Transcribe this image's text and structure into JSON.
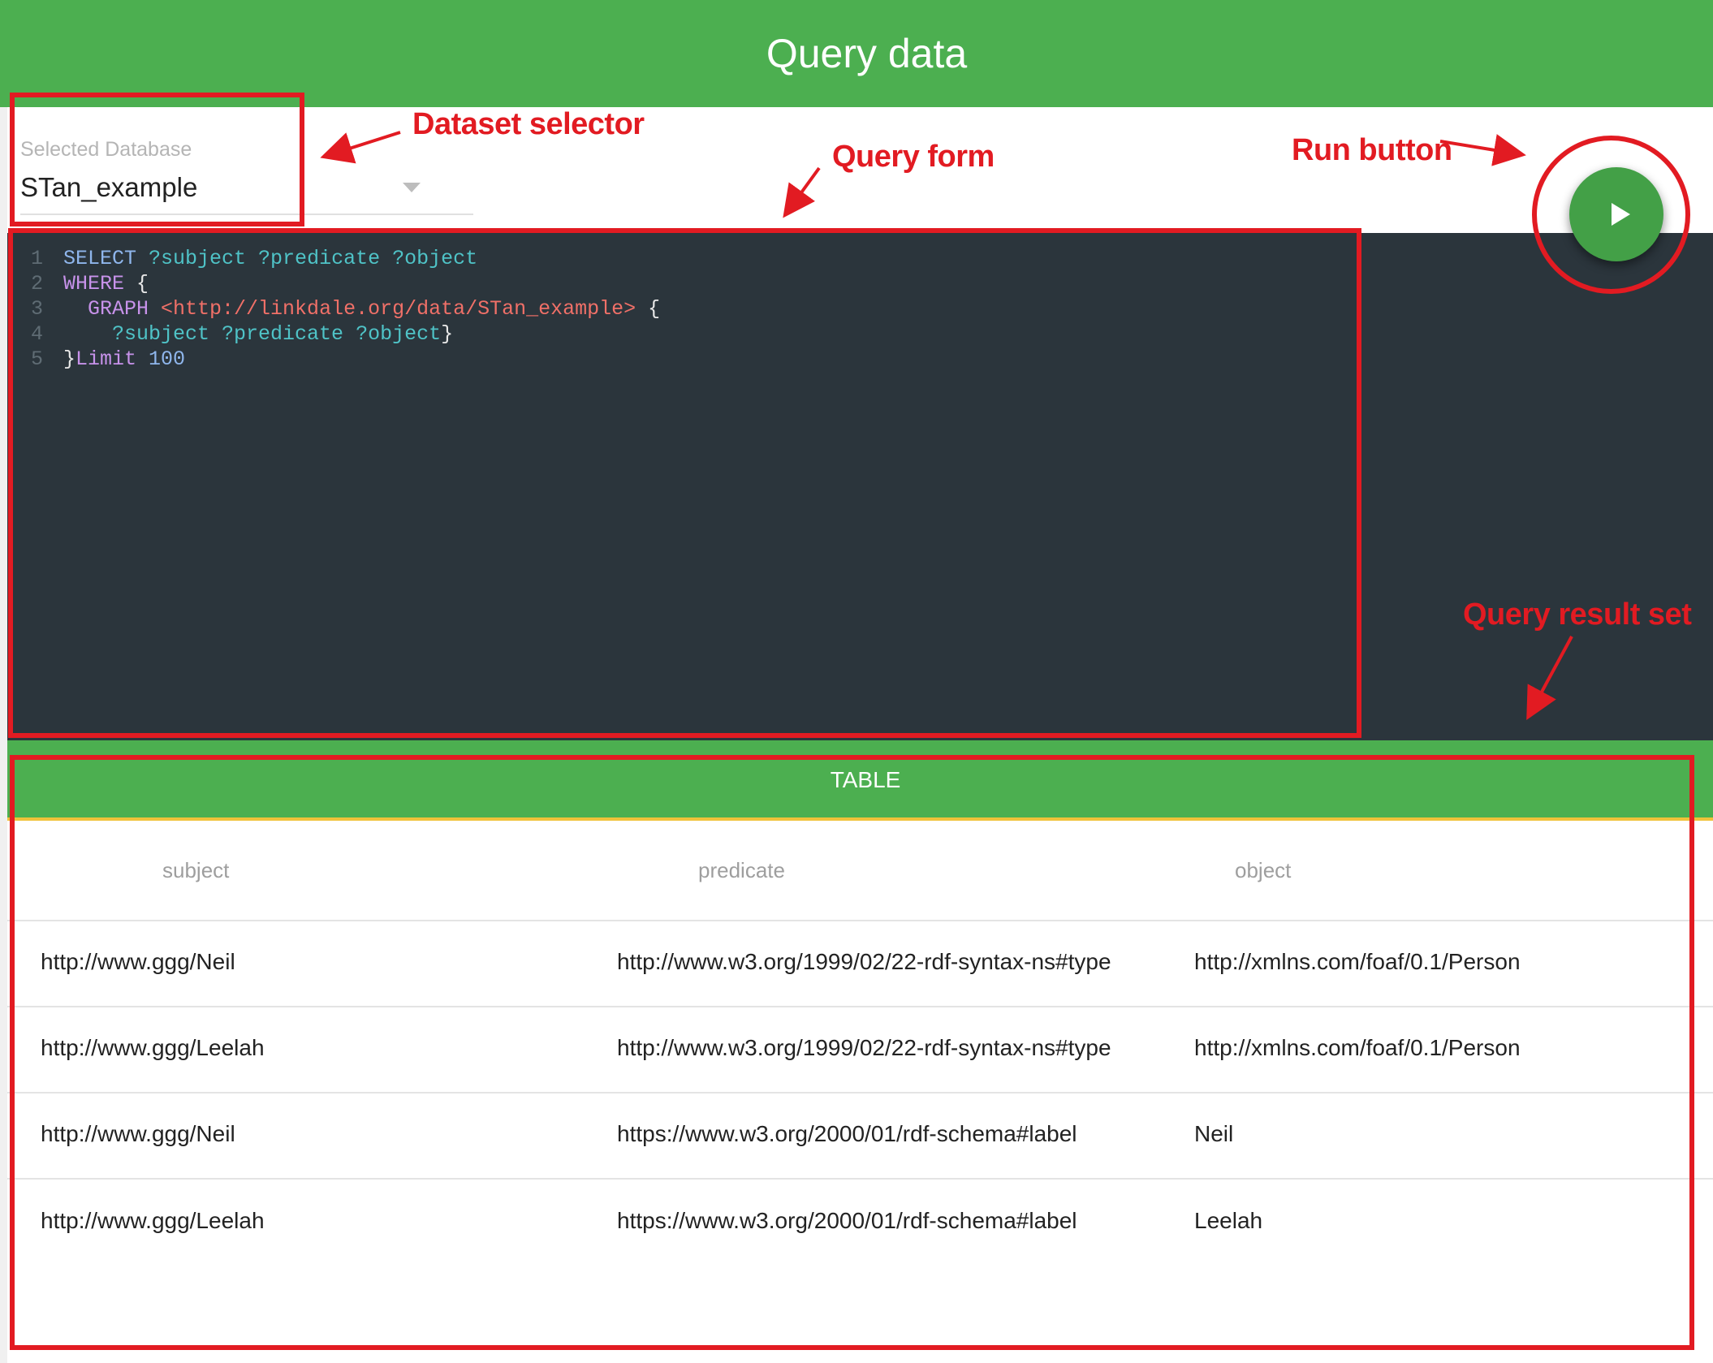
{
  "header": {
    "title": "Query data"
  },
  "database_selector": {
    "label": "Selected Database",
    "value": "STan_example"
  },
  "editor": {
    "lines": [
      {
        "num": "1",
        "tokens": [
          {
            "t": "SELECT ",
            "c": "kw"
          },
          {
            "t": "?subject ?predicate ?object",
            "c": "var"
          }
        ]
      },
      {
        "num": "2",
        "tokens": [
          {
            "t": "WHERE ",
            "c": "kw2"
          },
          {
            "t": "{",
            "c": "pl"
          }
        ]
      },
      {
        "num": "3",
        "tokens": [
          {
            "t": "  ",
            "c": "pl"
          },
          {
            "t": "GRAPH ",
            "c": "kw2"
          },
          {
            "t": "<http://linkdale.org/data/STan_example>",
            "c": "uri"
          },
          {
            "t": " {",
            "c": "pl"
          }
        ]
      },
      {
        "num": "4",
        "tokens": [
          {
            "t": "    ",
            "c": "pl"
          },
          {
            "t": "?subject ?predicate ?object",
            "c": "var"
          },
          {
            "t": "}",
            "c": "pl"
          }
        ]
      },
      {
        "num": "5",
        "tokens": [
          {
            "t": "}",
            "c": "pl"
          },
          {
            "t": "Limit ",
            "c": "kw2"
          },
          {
            "t": "100",
            "c": "num"
          }
        ]
      }
    ]
  },
  "run_button": {
    "icon": "play-icon"
  },
  "tabs": [
    {
      "label": "TABLE",
      "active": true
    }
  ],
  "table": {
    "columns": [
      "subject",
      "predicate",
      "object"
    ],
    "rows": [
      [
        "http://www.ggg/Neil",
        "http://www.w3.org/1999/02/22-rdf-syntax-ns#type",
        "http://xmlns.com/foaf/0.1/Person"
      ],
      [
        "http://www.ggg/Leelah",
        "http://www.w3.org/1999/02/22-rdf-syntax-ns#type",
        "http://xmlns.com/foaf/0.1/Person"
      ],
      [
        "http://www.ggg/Neil",
        "https://www.w3.org/2000/01/rdf-schema#label",
        "Neil"
      ],
      [
        "http://www.ggg/Leelah",
        "https://www.w3.org/2000/01/rdf-schema#label",
        "Leelah"
      ]
    ]
  },
  "annotations": {
    "dataset_selector": "Dataset selector",
    "query_form": "Query form",
    "run_button": "Run button",
    "query_result_set": "Query result set"
  },
  "colors": {
    "header": "#4caf50",
    "editor_bg": "#2b353c",
    "annotation": "#e21b22",
    "tab_indicator": "#f0c23a"
  }
}
